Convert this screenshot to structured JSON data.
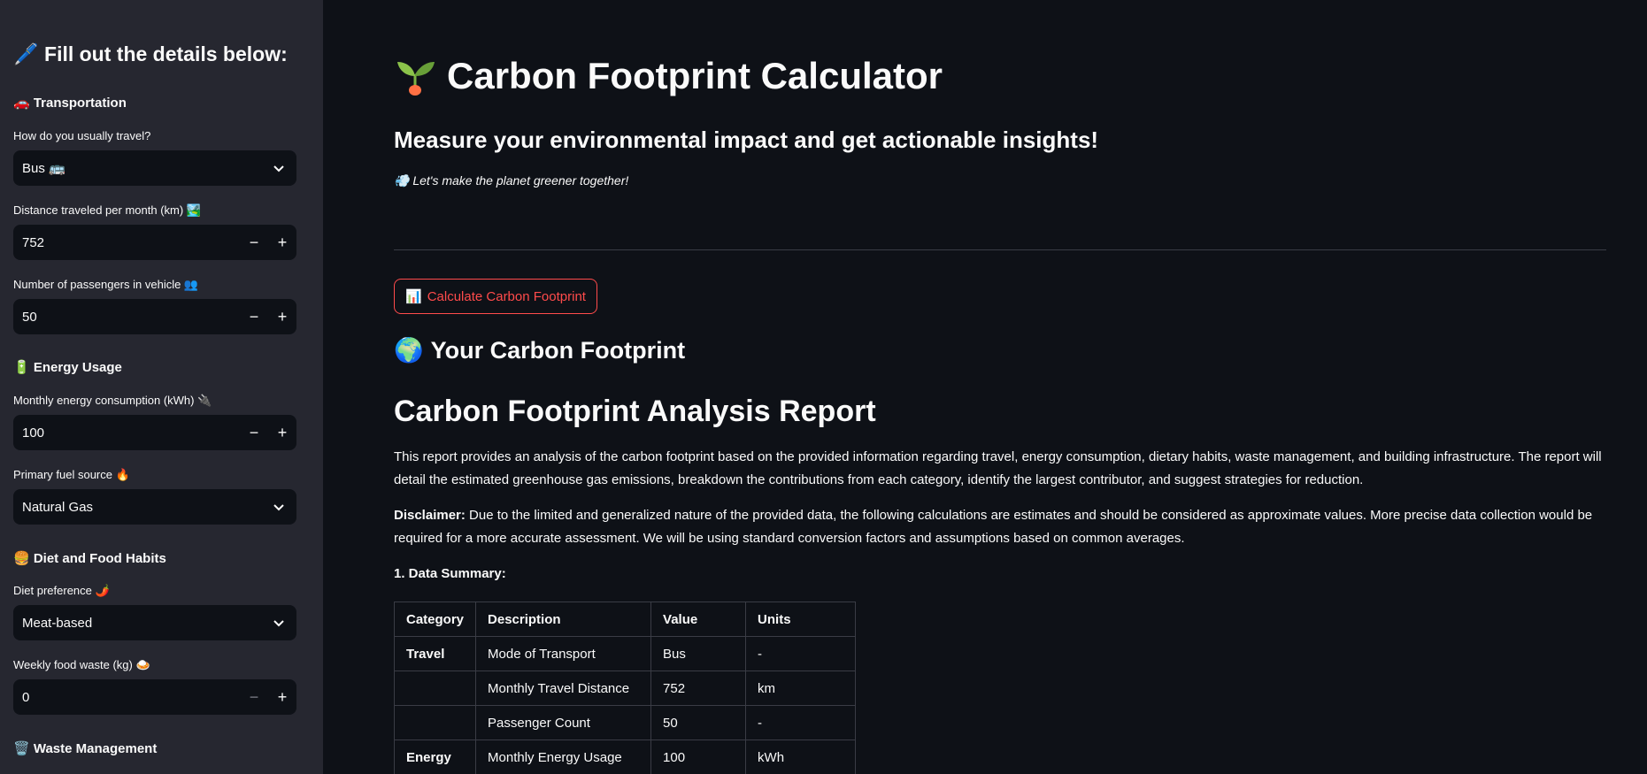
{
  "sidebar": {
    "header": "🖊️ Fill out the details below:",
    "transport_section": "🚗 Transportation",
    "travel_label": "How do you usually travel?",
    "travel_value": "Bus 🚌",
    "distance_label": "Distance traveled per month (km) 🏞️",
    "distance_value": "752",
    "passengers_label": "Number of passengers in vehicle 👥",
    "passengers_value": "50",
    "energy_section": "🔋 Energy Usage",
    "energy_label": "Monthly energy consumption (kWh) 🔌",
    "energy_value": "100",
    "fuel_label": "Primary fuel source 🔥",
    "fuel_value": "Natural Gas",
    "diet_section": "🍔 Diet and Food Habits",
    "diet_label": "Diet preference 🌶️",
    "diet_value": "Meat-based",
    "waste_label": "Weekly food waste (kg) 🍛",
    "waste_value": "0",
    "waste_section": "🗑️ Waste Management",
    "minus": "−",
    "plus": "+"
  },
  "main": {
    "title": "Carbon Footprint Calculator",
    "subtitle": "Measure your environmental impact and get actionable insights!",
    "tagline": "💨 Let's make the planet greener together!",
    "calc_button_icon": "📊",
    "calc_button": "Calculate Carbon Footprint",
    "footprint_icon": "🌍",
    "footprint_heading": "Your Carbon Footprint",
    "report_heading": "Carbon Footprint Analysis Report",
    "intro": "This report provides an analysis of the carbon footprint based on the provided information regarding travel, energy consumption, dietary habits, waste management, and building infrastructure. The report will detail the estimated greenhouse gas emissions, breakdown the contributions from each category, identify the largest contributor, and suggest strategies for reduction.",
    "disclaimer_label": "Disclaimer:",
    "disclaimer": " Due to the limited and generalized nature of the provided data, the following calculations are estimates and should be considered as approximate values. More precise data collection would be required for a more accurate assessment. We will be using standard conversion factors and assumptions based on common averages.",
    "data_summary": "1. Data Summary:"
  },
  "table": {
    "headers": [
      "Category",
      "Description",
      "Value",
      "Units"
    ],
    "rows": [
      [
        "Travel",
        "Mode of Transport",
        "Bus",
        "-"
      ],
      [
        "",
        "Monthly Travel Distance",
        "752",
        "km"
      ],
      [
        "",
        "Passenger Count",
        "50",
        "-"
      ],
      [
        "Energy",
        "Monthly Energy Usage",
        "100",
        "kWh"
      ]
    ]
  },
  "colors": {
    "accent": "#ff4b4b",
    "sidebar_bg": "#262730",
    "main_bg": "#0e1117"
  }
}
